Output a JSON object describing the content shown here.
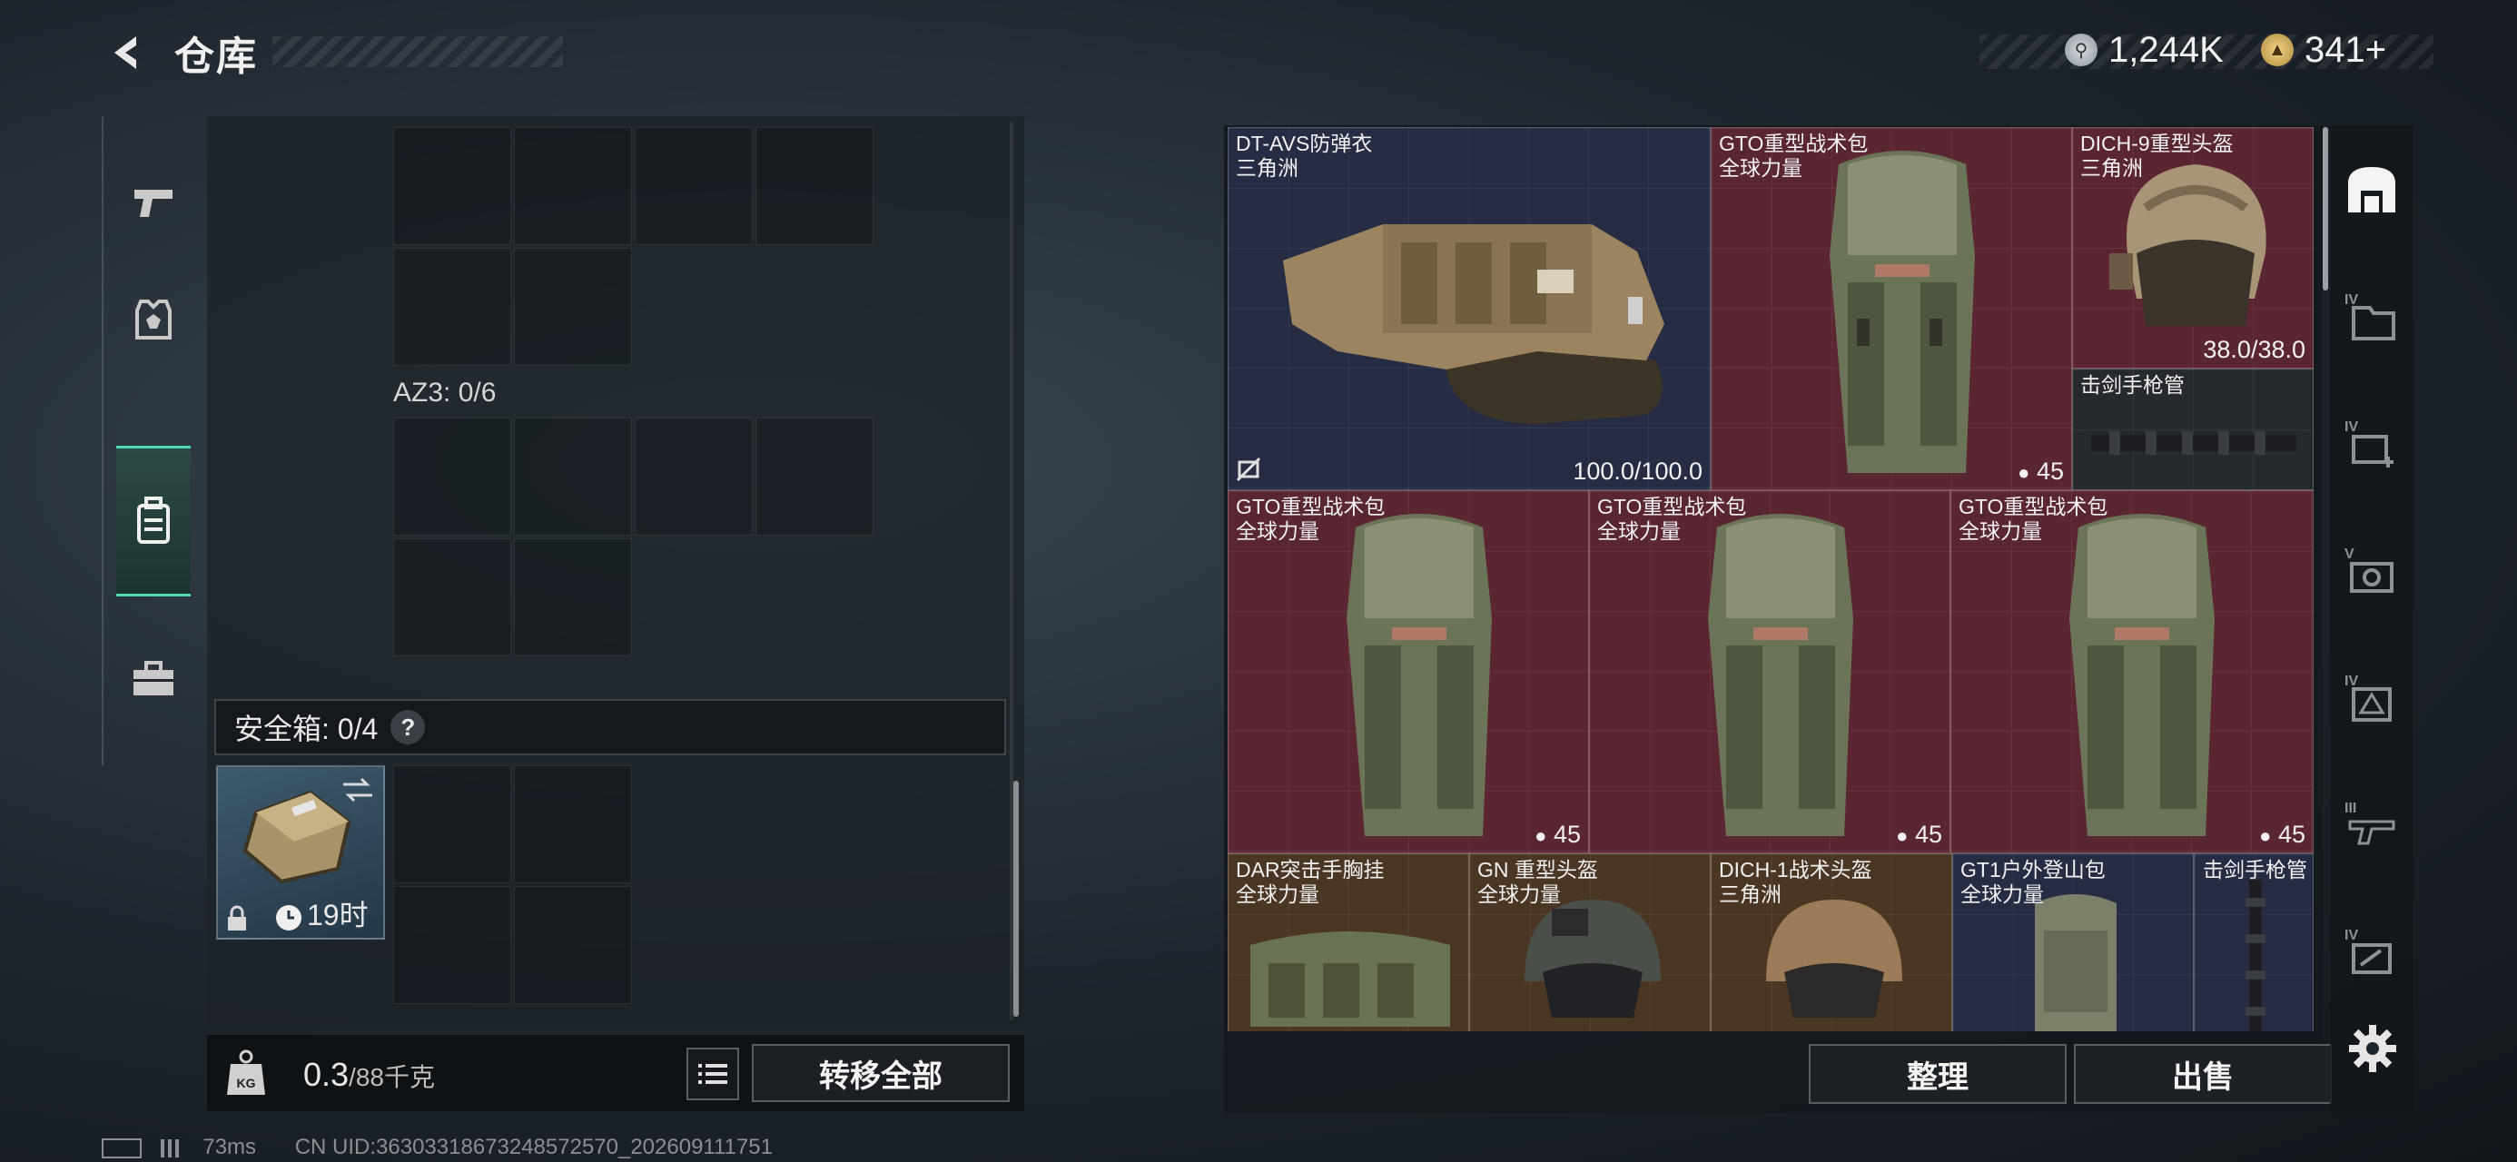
{
  "header": {
    "title": "仓库",
    "currency_silver": "1,244K",
    "currency_gold": "341+"
  },
  "left": {
    "az3_label": "AZ3: 0/6",
    "safe_box_label": "安全箱: 0/4",
    "safe_box_help": "?",
    "safe_box_time": "19时",
    "weight_current": "0.3",
    "weight_max": "/88千克",
    "kg_icon_text": "KG",
    "transfer_all": "转移全部"
  },
  "items": [
    {
      "name": "DT-AVS防弹衣",
      "sub": "三角洲",
      "value": "100.0/100.0"
    },
    {
      "name": "GTO重型战术包",
      "sub": "全球力量",
      "value": "45"
    },
    {
      "name": "DICH-9重型头盔",
      "sub": "三角洲",
      "value": "38.0/38.0"
    },
    {
      "name": "击剑手枪管",
      "sub": "",
      "value": ""
    },
    {
      "name": "GTO重型战术包",
      "sub": "全球力量",
      "value": "45"
    },
    {
      "name": "GTO重型战术包",
      "sub": "全球力量",
      "value": "45"
    },
    {
      "name": "GTO重型战术包",
      "sub": "全球力量",
      "value": "45"
    },
    {
      "name": "DAR突击手胸挂",
      "sub": "全球力量",
      "value": ""
    },
    {
      "name": "GN 重型头盔",
      "sub": "全球力量",
      "value": ""
    },
    {
      "name": "DICH-1战术头盔",
      "sub": "三角洲",
      "value": ""
    },
    {
      "name": "GT1户外登山包",
      "sub": "全球力量",
      "value": ""
    },
    {
      "name": "击剑手枪管",
      "sub": "",
      "value": ""
    }
  ],
  "right_buttons": {
    "sort": "整理",
    "sell": "出售"
  },
  "side_tiers": [
    "IV",
    "IV",
    "V",
    "IV",
    "III",
    "IV"
  ],
  "status_bar": {
    "ping": "73ms",
    "uid": "CN UID:36303318673248572570_202609111751"
  }
}
